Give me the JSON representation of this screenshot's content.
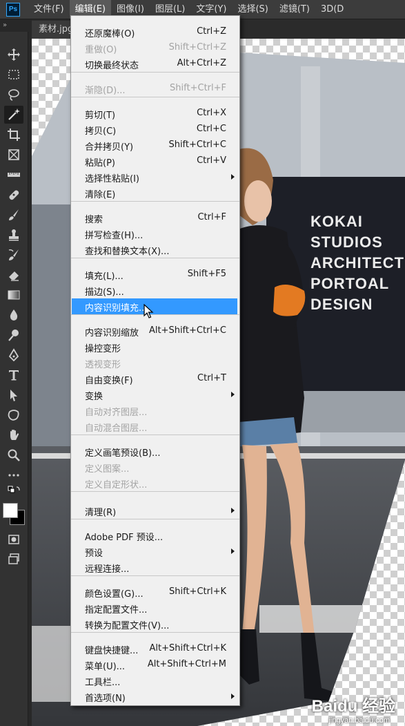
{
  "app": {
    "logo": "Ps"
  },
  "menubar": {
    "items": [
      "文件(F)",
      "编辑(E)",
      "图像(I)",
      "图层(L)",
      "文字(Y)",
      "选择(S)",
      "滤镜(T)",
      "3D(D"
    ]
  },
  "tab": {
    "title": "素材.jpg"
  },
  "toolbar": {
    "tools": [
      "move-icon",
      "marquee-icon",
      "lasso-icon",
      "magic-wand-icon",
      "crop-icon",
      "frame-icon",
      "ruler-icon",
      "healing-icon",
      "brush-icon",
      "stamp-icon",
      "history-brush-icon",
      "eraser-icon",
      "gradient-icon",
      "blur-icon",
      "dodge-icon",
      "pen-icon",
      "type-icon",
      "path-select-icon",
      "shape-icon",
      "hand-icon",
      "zoom-icon",
      "more-icon"
    ]
  },
  "edit_menu": {
    "items": [
      {
        "label": "还原魔棒(O)",
        "shortcut": "Ctrl+Z",
        "disabled": false
      },
      {
        "label": "重做(O)",
        "shortcut": "Shift+Ctrl+Z",
        "disabled": true
      },
      {
        "label": "切换最终状态",
        "shortcut": "Alt+Ctrl+Z",
        "disabled": false
      },
      {
        "label": "渐隐(D)...",
        "shortcut": "Shift+Ctrl+F",
        "disabled": true
      },
      {
        "label": "剪切(T)",
        "shortcut": "Ctrl+X",
        "disabled": false
      },
      {
        "label": "拷贝(C)",
        "shortcut": "Ctrl+C",
        "disabled": false
      },
      {
        "label": "合并拷贝(Y)",
        "shortcut": "Shift+Ctrl+C",
        "disabled": false
      },
      {
        "label": "粘贴(P)",
        "shortcut": "Ctrl+V",
        "disabled": false
      },
      {
        "label": "选择性粘贴(I)",
        "shortcut": "",
        "disabled": false,
        "submenu": true
      },
      {
        "label": "清除(E)",
        "shortcut": "",
        "disabled": false
      },
      {
        "label": "搜索",
        "shortcut": "Ctrl+F",
        "disabled": false
      },
      {
        "label": "拼写检查(H)...",
        "shortcut": "",
        "disabled": false
      },
      {
        "label": "查找和替换文本(X)...",
        "shortcut": "",
        "disabled": false
      },
      {
        "label": "填充(L)...",
        "shortcut": "Shift+F5",
        "disabled": false
      },
      {
        "label": "描边(S)...",
        "shortcut": "",
        "disabled": false
      },
      {
        "label": "内容识别填充...",
        "shortcut": "",
        "disabled": false,
        "highlighted": true
      },
      {
        "label": "内容识别缩放",
        "shortcut": "Alt+Shift+Ctrl+C",
        "disabled": false
      },
      {
        "label": "操控变形",
        "shortcut": "",
        "disabled": false
      },
      {
        "label": "透视变形",
        "shortcut": "",
        "disabled": true
      },
      {
        "label": "自由变换(F)",
        "shortcut": "Ctrl+T",
        "disabled": false
      },
      {
        "label": "变换",
        "shortcut": "",
        "disabled": false,
        "submenu": true
      },
      {
        "label": "自动对齐图层...",
        "shortcut": "",
        "disabled": true
      },
      {
        "label": "自动混合图层...",
        "shortcut": "",
        "disabled": true
      },
      {
        "label": "定义画笔预设(B)...",
        "shortcut": "",
        "disabled": false
      },
      {
        "label": "定义图案...",
        "shortcut": "",
        "disabled": true
      },
      {
        "label": "定义自定形状...",
        "shortcut": "",
        "disabled": true
      },
      {
        "label": "清理(R)",
        "shortcut": "",
        "disabled": false,
        "submenu": true
      },
      {
        "label": "Adobe PDF 预设...",
        "shortcut": "",
        "disabled": false
      },
      {
        "label": "预设",
        "shortcut": "",
        "disabled": false,
        "submenu": true
      },
      {
        "label": "远程连接...",
        "shortcut": "",
        "disabled": false
      },
      {
        "label": "颜色设置(G)...",
        "shortcut": "Shift+Ctrl+K",
        "disabled": false
      },
      {
        "label": "指定配置文件...",
        "shortcut": "",
        "disabled": false
      },
      {
        "label": "转换为配置文件(V)...",
        "shortcut": "",
        "disabled": false
      },
      {
        "label": "键盘快捷键...",
        "shortcut": "Alt+Shift+Ctrl+K",
        "disabled": false
      },
      {
        "label": "菜单(U)...",
        "shortcut": "Alt+Shift+Ctrl+M",
        "disabled": false
      },
      {
        "label": "工具栏...",
        "shortcut": "",
        "disabled": false
      },
      {
        "label": "首选项(N)",
        "shortcut": "",
        "disabled": false,
        "submenu": true
      }
    ]
  },
  "photo": {
    "building_sign": [
      "KOKAI",
      "STUDIOS",
      "ARCHITECT",
      "PORTOAL",
      "DESIGN"
    ],
    "colors": {
      "sky": "#b9bfc6",
      "building": "#1d1f27",
      "road": "#4a4d52",
      "jacket": "#1a1a1e"
    }
  },
  "watermark": {
    "text": "Baidu 经验",
    "sub": "jingyan.baidu.com"
  }
}
